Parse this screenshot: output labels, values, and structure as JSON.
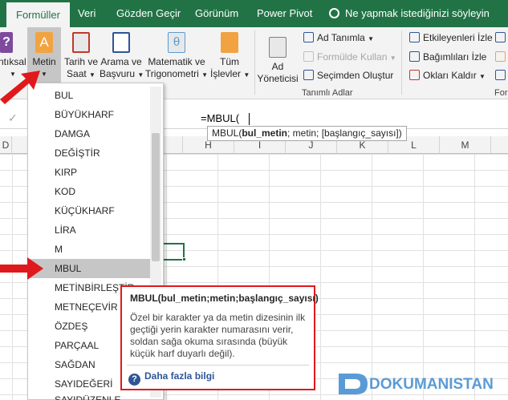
{
  "tabs": [
    {
      "label": "Formüller",
      "active": true
    },
    {
      "label": "Veri",
      "active": false
    },
    {
      "label": "Gözden Geçir",
      "active": false
    },
    {
      "label": "Görünüm",
      "active": false
    },
    {
      "label": "Power Pivot",
      "active": false
    }
  ],
  "tell_me": "Ne yapmak istediğinizi söyleyin",
  "ribbon": {
    "mantiksal": "ntıksal",
    "metin": "Metin",
    "tarih_1": "Tarih ve",
    "tarih_2": "Saat",
    "arama_1": "Arama ve",
    "arama_2": "Başvuru",
    "mat_1": "Matematik ve",
    "mat_2": "Trigonometri",
    "tum_1": "Tüm",
    "tum_2": "İşlevler",
    "ad_1": "Ad",
    "ad_2": "Yöneticisi",
    "ad_tanimla": "Ad Tanımla",
    "formulde": "Formülde Kullan",
    "secimden": "Seçimden Oluştur",
    "tanimli_adlar": "Tanımlı Adlar",
    "etkileyenler": "Etkileyenleri İzle",
    "bagimlilar": "Bağımlıları İzle",
    "oklari": "Okları Kaldır",
    "for_group": "For"
  },
  "formula_bar": {
    "value": "=MBUL(",
    "tooltip_fn": "MBUL(",
    "tooltip_arg_bold": "bul_metin",
    "tooltip_rest": "; metin; [başlangıç_sayısı])"
  },
  "columns": [
    "D",
    "H",
    "I",
    "J",
    "K",
    "L",
    "M"
  ],
  "menu_items": [
    "BUL",
    "BÜYÜKHARF",
    "DAMGA",
    "DEĞİŞTİR",
    "KIRP",
    "KOD",
    "KÜÇÜKHARF",
    "LİRA",
    "M",
    "MBUL",
    "METİNBİRLEŞTİR",
    "METNEÇEVİR",
    "ÖZDEŞ",
    "PARÇAAL",
    "SAĞDAN",
    "SAYIDEĞERİ",
    "SAYIDÜZENLE"
  ],
  "help": {
    "title": "MBUL(bul_metin;metin;başlangıç_sayısı)",
    "description": "Özel bir karakter ya da metin dizesinin ilk geçtiği yerin karakter numarasını verir, soldan sağa okuma sırasında (büyük küçük harf duyarlı değil).",
    "link": "Daha fazla bilgi"
  },
  "watermark": "DOKUMANISTAN",
  "colors": {
    "excel_green": "#217346",
    "highlight": "#c6c6c6",
    "red": "#e0191c",
    "link": "#2f5597"
  }
}
